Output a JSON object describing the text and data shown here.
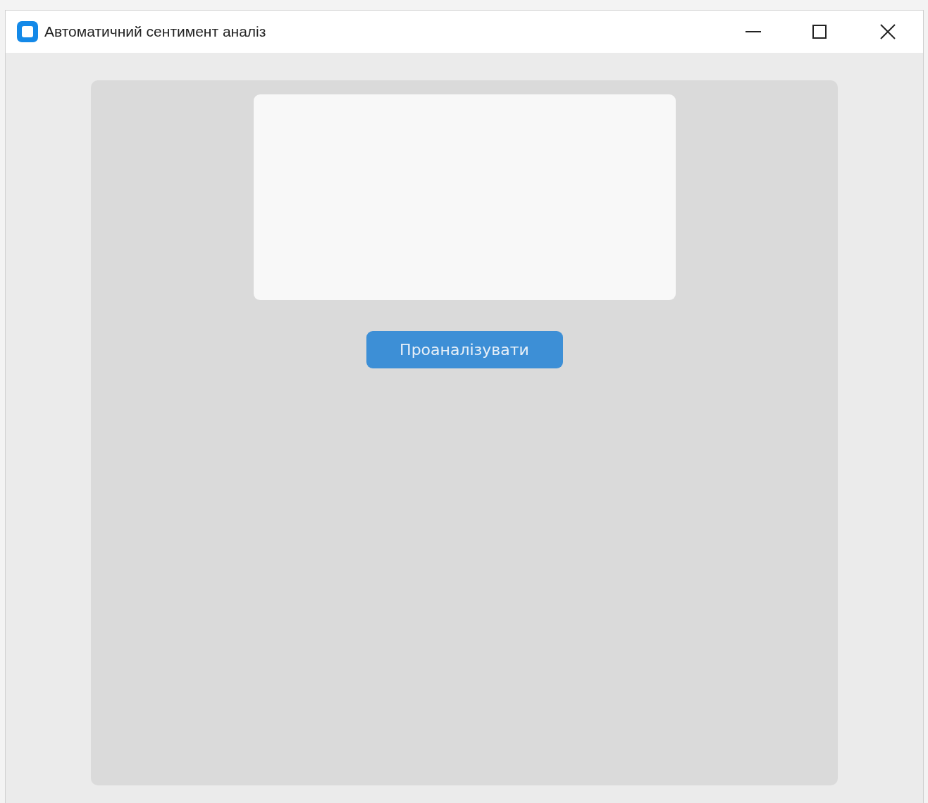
{
  "window": {
    "title": "Автоматичний сентимент аналіз"
  },
  "analyze_button": {
    "label": "Проаналізувати"
  }
}
